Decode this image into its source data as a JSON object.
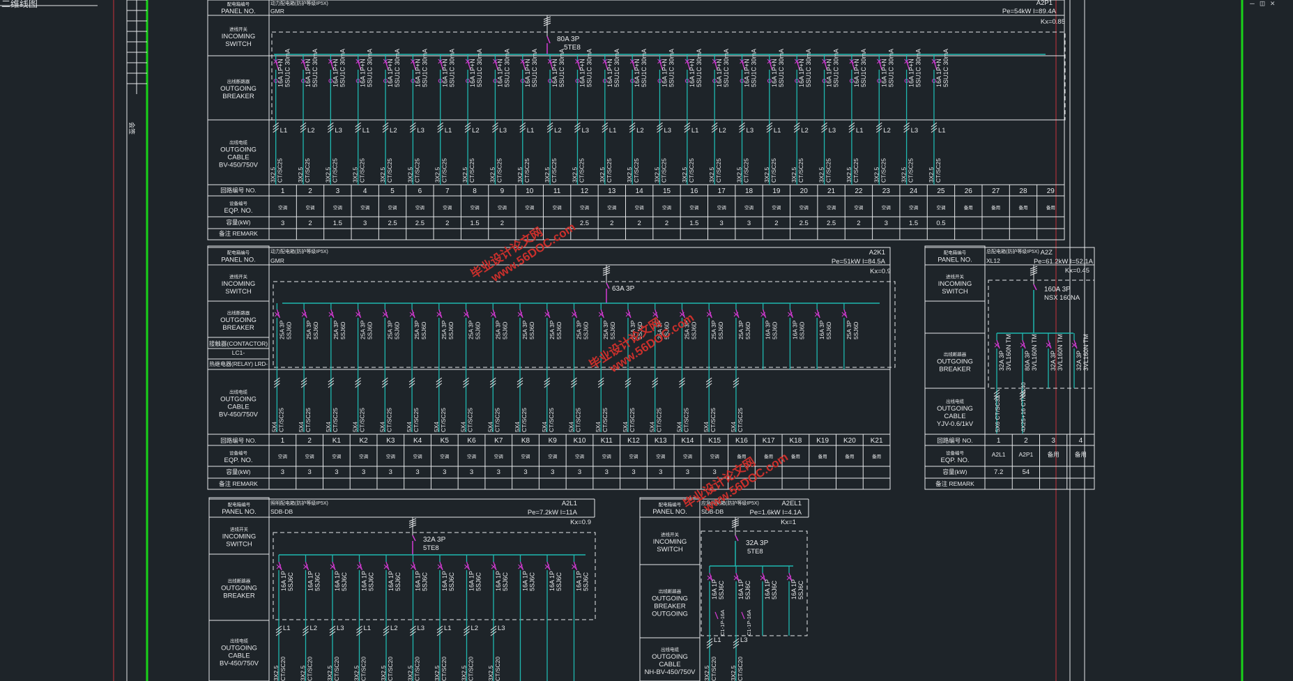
{
  "title_fragment": "二维线图",
  "window_controls": [
    "—",
    "◫",
    "✕"
  ],
  "side_label": "会签",
  "labels": {
    "panel_cn": "配电箱编号",
    "panel_en": "PANEL NO.",
    "incoming_cn": "进线开关",
    "incoming_en": [
      "INCOMING",
      "SWITCH"
    ],
    "breaker_cn": "出线断路器",
    "breaker_en": [
      "OUTGOING",
      "BREAKER"
    ],
    "cable_cn": "出线电缆",
    "cable_en": [
      "OUTGOING",
      "CABLE"
    ],
    "circuit_cn": "回路编号 NO.",
    "eqp_cn": "设备编号",
    "eqp_en": "EQP. NO.",
    "power_cn": "容量(kW)",
    "remark": "备注 REMARK",
    "contactor": "接触器(CONTACTOR) LC1-",
    "relay": "热继电器(RELAY) LRD-",
    "spare": "备用",
    "fan": "空调"
  },
  "panels": [
    {
      "id": "A2P1",
      "type_text": "动力配电箱(防护等级IP5X)",
      "model": "GMR",
      "pe": "Pe=54kW I=89.4A",
      "kx": "Kx=0.85",
      "incoming": [
        "80A 3P",
        "5TE8"
      ],
      "breaker_text": [
        "16A 1P+N",
        "5SU1C 30mA"
      ],
      "cable_unit": "BV-450/750V",
      "cable_types": [
        "3X2.5",
        "CT/SC25"
      ],
      "phases": [
        "L1",
        "L2",
        "L3",
        "L1",
        "L2",
        "L3",
        "L1",
        "L2",
        "L3",
        "L1",
        "L2",
        "L3",
        "L1",
        "L2",
        "L3",
        "L1",
        "L2",
        "L3",
        "L1",
        "L2",
        "L3",
        "L1",
        "L2",
        "L3",
        "L1"
      ],
      "numbers": [
        "1",
        "2",
        "3",
        "4",
        "5",
        "6",
        "7",
        "8",
        "9",
        "10",
        "11",
        "12",
        "13",
        "14",
        "15",
        "16",
        "17",
        "18",
        "19",
        "20",
        "21",
        "22",
        "23",
        "24",
        "25",
        "26",
        "27",
        "28",
        "29"
      ],
      "powers": [
        "3",
        "2",
        "1.5",
        "3",
        "2.5",
        "2.5",
        "2",
        "1.5",
        "2",
        "",
        "",
        "2.5",
        "2",
        "2",
        "2",
        "1.5",
        "3",
        "3",
        "2",
        "2.5",
        "2.5",
        "2",
        "3",
        "1.5",
        "0.5",
        "",
        "",
        "",
        ""
      ]
    },
    {
      "id": "A2K1",
      "type_text": "动力配电箱(防护等级IP5X)",
      "model": "GMR",
      "pe": "Pe=51kW I=84.5A",
      "kx": "Kx=0.9",
      "incoming": [
        "63A 3P"
      ],
      "breaker_text": [
        "25A 3P",
        "5SJ6D"
      ],
      "cable_unit": "BV-450/750V",
      "cable_types": [
        "5X4",
        "CT/SC25"
      ],
      "numbers": [
        "1",
        "2",
        "K1",
        "K2",
        "K3",
        "K4",
        "K5",
        "K6",
        "K7",
        "K8",
        "K9",
        "K10",
        "K11",
        "K12",
        "K13",
        "K14",
        "K15",
        "K16",
        "K17",
        "K18",
        "K19",
        "K20",
        "K21"
      ],
      "powers": [
        "3",
        "3",
        "3",
        "3",
        "3",
        "3",
        "3",
        "3",
        "3",
        "3",
        "3",
        "3",
        "3",
        "3",
        "3",
        "3",
        "3",
        "",
        "",
        "",
        "",
        "",
        ""
      ]
    },
    {
      "id": "A2Z",
      "type_text": "总配电箱(防护等级IP5X)",
      "model": "XL12",
      "pe": "Pe=61.2kW I=52.1A",
      "kx": "Kx=0.45",
      "incoming": [
        "160A 3P",
        "NSX 160NA"
      ],
      "breakers": [
        "32A 3P",
        "80A 3P",
        "32A 3P",
        "32A 3P"
      ],
      "breaker_sub": "3VL160N TM",
      "cable_unit": "YJV-0.6/1kV",
      "cable_types": [
        "5X6 CT/SC32",
        "4X25+16 CT/SC40"
      ],
      "numbers": [
        "1",
        "2",
        "3",
        "4"
      ],
      "eqp": [
        "A2L1",
        "A2P1",
        "备用",
        "备用"
      ],
      "powers": [
        "7.2",
        "54",
        "",
        ""
      ]
    },
    {
      "id": "A2L1",
      "type_text": "照明配电箱(防护等级IP5X)",
      "model": "SDB-DB",
      "pe": "Pe=7.2kW I=11A",
      "kx": "Kx=0.9",
      "incoming": [
        "32A 3P",
        "5TE8"
      ],
      "breaker_text": [
        "16A 1P",
        "5SJ6C"
      ],
      "cable_unit": "BV-450/750V",
      "cable_types": [
        "3X2.5",
        "CT/SC20"
      ],
      "phases": [
        "L1",
        "L2",
        "L3",
        "L1",
        "L2",
        "L3",
        "L1",
        "L2",
        "L3"
      ]
    },
    {
      "id": "A2EL1",
      "type_text": "应急照明箱(防护等级IP5X)",
      "model": "SDB-DB",
      "pe": "Pe=1.6kW I=4.1A",
      "kx": "Kx=1",
      "incoming": [
        "32A 3P",
        "5TE8"
      ],
      "breaker_text": [
        "16A 1P",
        "5SJ6C"
      ],
      "breaker_mid": "C1-1P-16A",
      "cable_unit": "NH-BV-450/750V",
      "cable_types": [
        "3X2.5",
        "CT/SC20"
      ],
      "phases": [
        "L1",
        "L3"
      ]
    }
  ],
  "watermarks": [
    "毕业设计论文网",
    "www.56DOC.com"
  ],
  "colors": {
    "background": "#1e2429",
    "line": "#e6e8ea",
    "bus": "#1fb8b0",
    "breaker": "#d43bd4",
    "frame_green": "#19d219",
    "frame_red": "#c8323c",
    "watermark": "#c9302c"
  }
}
